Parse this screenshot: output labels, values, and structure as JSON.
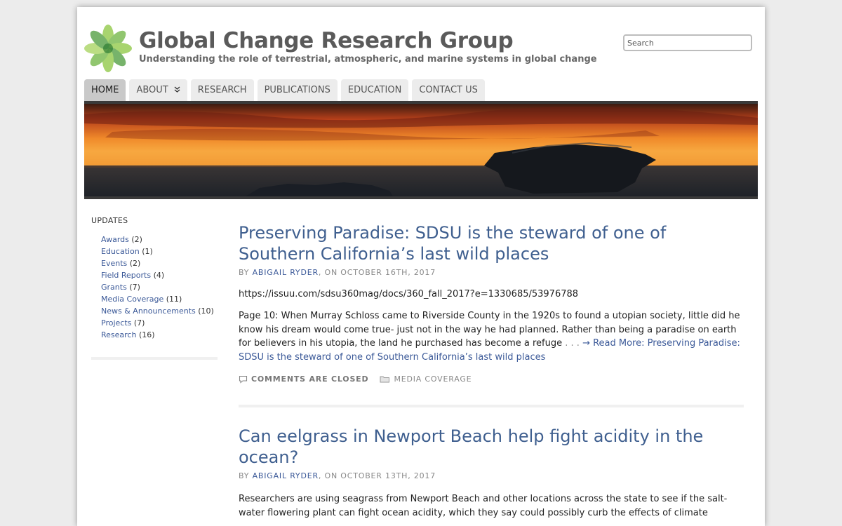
{
  "site": {
    "title": "Global Change Research Group",
    "tagline": "Understanding the role of terrestrial, atmospheric, and marine systems in global change"
  },
  "search": {
    "placeholder": "Search"
  },
  "nav": {
    "items": [
      {
        "label": "HOME"
      },
      {
        "label": "ABOUT"
      },
      {
        "label": "RESEARCH"
      },
      {
        "label": "PUBLICATIONS"
      },
      {
        "label": "EDUCATION"
      },
      {
        "label": "CONTACT US"
      }
    ]
  },
  "sidebar": {
    "title": "UPDATES",
    "categories": [
      {
        "name": "Awards",
        "count": "(2)"
      },
      {
        "name": "Education",
        "count": "(1)"
      },
      {
        "name": "Events",
        "count": "(2)"
      },
      {
        "name": "Field Reports",
        "count": "(4)"
      },
      {
        "name": "Grants",
        "count": "(7)"
      },
      {
        "name": "Media Coverage",
        "count": "(11)"
      },
      {
        "name": "News & Announcements",
        "count": "(10)"
      },
      {
        "name": "Projects",
        "count": "(7)"
      },
      {
        "name": "Research",
        "count": "(16)"
      }
    ]
  },
  "posts": [
    {
      "title": "Preserving Paradise: SDSU is the steward of one of Southern California’s last wild places",
      "by": "BY",
      "author": "ABIGAIL RYDER",
      "date": ", ON OCTOBER 16TH, 2017",
      "url": "https://issuu.com/sdsu360mag/docs/360_fall_2017?e=1330685/53976788",
      "excerpt": "Page 10: When Murray Schloss came to Riverside County in the 1920s to found a utopian society, little did he know his dream would come true- just not in the way he had planned. Rather than being a paradise on earth for believers in his utopia, the land he purchased has become a refuge",
      "dots": " . . . ",
      "read_more": "→ Read More: Preserving Paradise: SDSU is the steward of one of Southern California’s last wild places",
      "comments": "COMMENTS ARE CLOSED",
      "category": "MEDIA COVERAGE"
    },
    {
      "title": "Can eelgrass in Newport Beach help fight acidity in the ocean?",
      "by": "BY",
      "author": "ABIGAIL RYDER",
      "date": ", ON OCTOBER 13TH, 2017",
      "excerpt": "Researchers are using seagrass from Newport Beach and other locations across the state to see if the salt-water flowering plant can fight ocean acidity, which they say could possibly curb the effects of climate"
    }
  ]
}
